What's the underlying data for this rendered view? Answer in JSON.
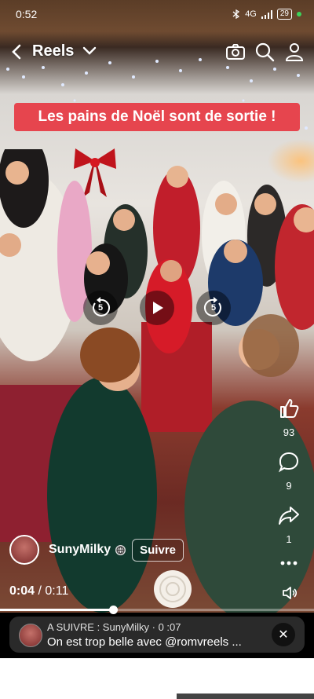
{
  "status": {
    "time": "0:52",
    "network": "4G",
    "battery": "29"
  },
  "header": {
    "title": "Reels"
  },
  "video": {
    "caption": "Les pains de Noël sont de sortie !",
    "rewind_seconds": "5",
    "forward_seconds": "5"
  },
  "actions": {
    "likes": "93",
    "comments": "9",
    "shares": "1"
  },
  "author": {
    "name": "SunyMilky",
    "follow_label": "Suivre"
  },
  "playback": {
    "current": "0:04",
    "separator": "/",
    "duration": "0:11",
    "progress": 0.36
  },
  "up_next": {
    "meta": "A SUIVRE : SunyMilky · 0 :07",
    "title": "On est trop belle avec @romvreels ..."
  },
  "colors": {
    "caption_bg": "#e6454e",
    "accent": "#3cd35a"
  }
}
